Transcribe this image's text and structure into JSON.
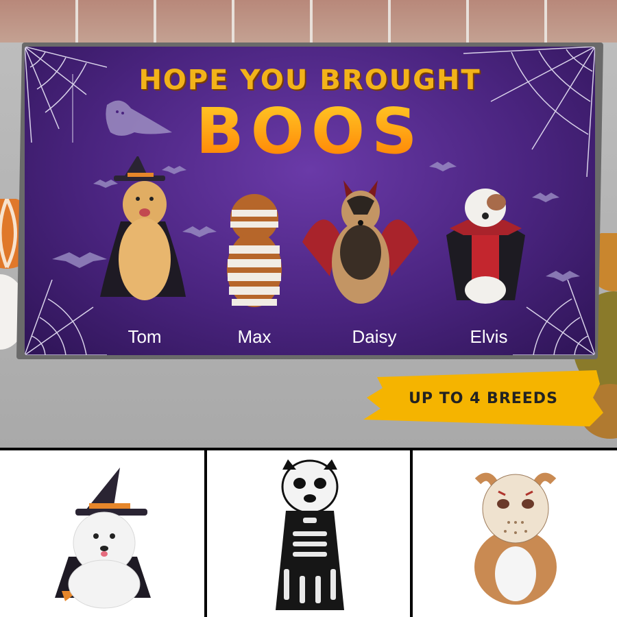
{
  "doormat": {
    "headline_line1": "HOPE YOU BROUGHT",
    "headline_line2": "BOOS",
    "dogs": [
      {
        "name": "Tom",
        "costume": "witch"
      },
      {
        "name": "Max",
        "costume": "mummy"
      },
      {
        "name": "Daisy",
        "costume": "devil"
      },
      {
        "name": "Elvis",
        "costume": "vampire"
      }
    ]
  },
  "badge": {
    "text": "UP TO 4 BREEDS"
  },
  "options": [
    {
      "name": "pomeranian-witch-option"
    },
    {
      "name": "skeleton-dog-option"
    },
    {
      "name": "bulldog-hockey-mask-option"
    }
  ],
  "colors": {
    "mat_purple": "#4a247f",
    "headline_orange": "#f2b31a",
    "badge_yellow": "#f5b400"
  }
}
